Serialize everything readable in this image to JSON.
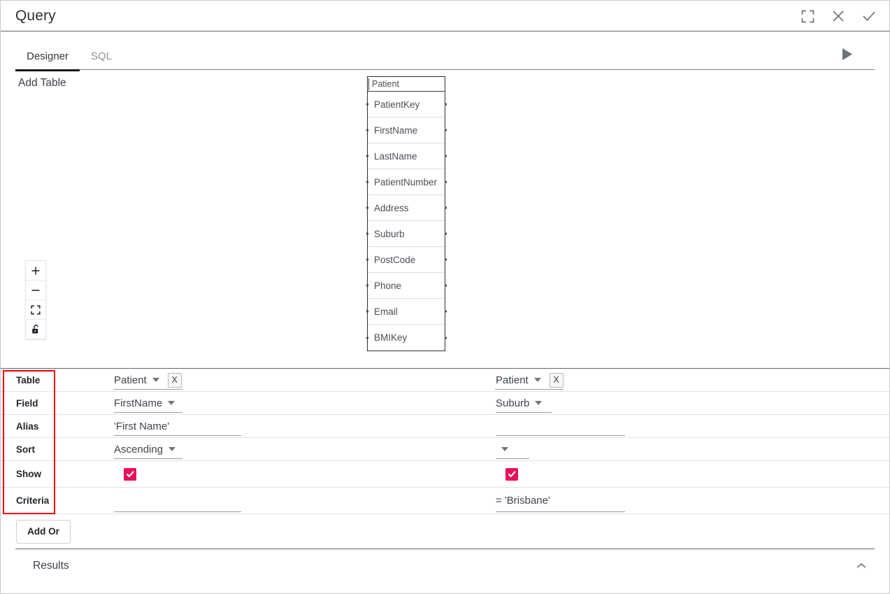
{
  "window": {
    "title": "Query",
    "actions": [
      {
        "name": "expand-icon",
        "label": "Expand"
      },
      {
        "name": "close-icon",
        "label": "Close"
      },
      {
        "name": "confirm-icon",
        "label": "Confirm"
      }
    ]
  },
  "tabs": [
    {
      "label": "Designer",
      "active": true
    },
    {
      "label": "SQL",
      "active": false
    }
  ],
  "toolbar": {
    "run_label": "Run",
    "add_table_label": "Add Table"
  },
  "zoom_controls": [
    {
      "name": "zoom-in-icon",
      "label": "+"
    },
    {
      "name": "zoom-out-icon",
      "label": "—"
    },
    {
      "name": "fit-screen-icon",
      "label": "Fit"
    },
    {
      "name": "unlock-icon",
      "label": "Unlock"
    }
  ],
  "entity": {
    "name": "Patient",
    "fields": [
      "PatientKey",
      "FirstName",
      "LastName",
      "PatientNumber",
      "Address",
      "Suburb",
      "PostCode",
      "Phone",
      "Email",
      "BMIKey"
    ]
  },
  "grid": {
    "row_labels": [
      "Table",
      "Field",
      "Alias",
      "Sort",
      "Show",
      "Criteria"
    ],
    "remove_label": "X",
    "columns": [
      {
        "table": "Patient",
        "field": "FirstName",
        "alias": "'First Name'",
        "sort": "Ascending",
        "show": true,
        "criteria": ""
      },
      {
        "table": "Patient",
        "field": "Suburb",
        "alias": "",
        "sort": "",
        "show": true,
        "criteria": "= 'Brisbane'"
      }
    ]
  },
  "add_or": {
    "label": "Add Or"
  },
  "results": {
    "label": "Results"
  },
  "colors": {
    "checkbox": "#e8115b",
    "annotation": "#ee0000",
    "tab_active": "#16181b",
    "divider": "#5d6672"
  }
}
